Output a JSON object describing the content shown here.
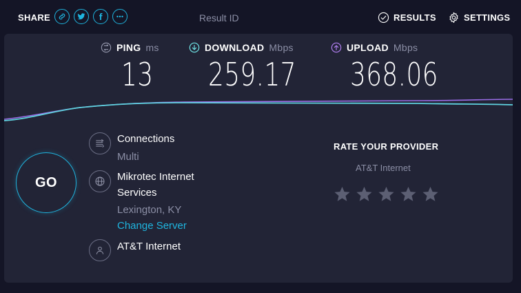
{
  "topbar": {
    "share_label": "SHARE",
    "share_icons": [
      "link-icon",
      "twitter-icon",
      "facebook-icon",
      "more-icon"
    ],
    "result_id_label": "Result ID",
    "results_label": "RESULTS",
    "settings_label": "SETTINGS"
  },
  "metrics": {
    "ping": {
      "label": "PING",
      "unit": "ms",
      "value": "13",
      "icon": "ping-icon"
    },
    "download": {
      "label": "DOWNLOAD",
      "unit": "Mbps",
      "value": "259.17",
      "icon": "download-icon"
    },
    "upload": {
      "label": "UPLOAD",
      "unit": "Mbps",
      "value": "368.06",
      "icon": "upload-icon"
    }
  },
  "go_label": "GO",
  "connections": {
    "label": "Connections",
    "value": "Multi"
  },
  "server": {
    "name_line1": "Mikrotec Internet",
    "name_line2": "Services",
    "location": "Lexington, KY",
    "change_label": "Change Server"
  },
  "isp": {
    "name": "AT&T Internet"
  },
  "rate": {
    "title": "RATE YOUR PROVIDER",
    "isp": "AT&T Internet",
    "stars_total": 5,
    "stars_selected": 0
  },
  "colors": {
    "accent_cyan": "#1fb5df",
    "accent_purple": "#9b6ee8",
    "panel_bg": "#222436",
    "page_bg": "#141526",
    "muted_text": "#8c8fa6",
    "star_inactive": "#5c5f73"
  }
}
